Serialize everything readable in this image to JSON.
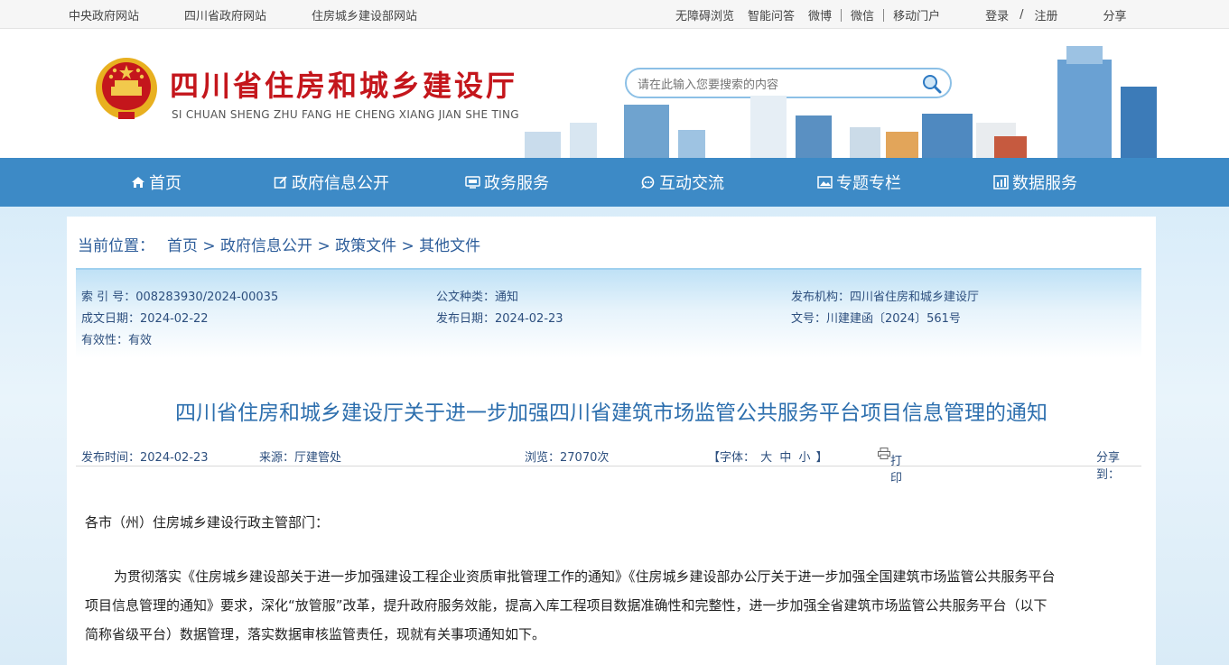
{
  "topbar": {
    "left_links": [
      "中央政府网站",
      "四川省政府网站",
      "住房城乡建设部网站"
    ],
    "right_links": [
      "无障碍浏览",
      "智能问答",
      "微博",
      "微信",
      "移动门户"
    ],
    "login": "登录",
    "slash": "/",
    "register": "注册",
    "share": "分享"
  },
  "header": {
    "title": "四川省住房和城乡建设厅",
    "subtitle": "SI CHUAN SHENG ZHU FANG HE CHENG XIANG JIAN SHE TING",
    "search_placeholder": "请在此输入您要搜索的内容"
  },
  "nav": {
    "items": [
      {
        "label": "首页",
        "icon": "home-icon"
      },
      {
        "label": "政府信息公开",
        "icon": "edit-icon"
      },
      {
        "label": "政务服务",
        "icon": "monitor-icon"
      },
      {
        "label": "互动交流",
        "icon": "chat-icon"
      },
      {
        "label": "专题专栏",
        "icon": "image-icon"
      },
      {
        "label": "数据服务",
        "icon": "chart-icon"
      }
    ]
  },
  "breadcrumb": {
    "label": "当前位置：",
    "path": "首页 > 政府信息公开 > 政策文件 > 其他文件"
  },
  "meta": {
    "index_no": "索 引 号：008283930/2024-00035",
    "doc_type": "公文种类：通知",
    "publisher": "发布机构：四川省住房和城乡建设厅",
    "created": "成文日期：2024-02-22",
    "published": "发布日期：2024-02-23",
    "doc_no": "文号：川建建函〔2024〕561号",
    "validity": "有效性：有效"
  },
  "article": {
    "title": "四川省住房和城乡建设厅关于进一步加强四川省建筑市场监管公共服务平台项目信息管理的通知",
    "publish_time": "发布时间：2024-02-23",
    "source": "来源：厅建管处",
    "views": "浏览：27070次",
    "font_label": "【字体：",
    "font_large": "大",
    "font_medium": "中",
    "font_small": "小",
    "font_close": "】",
    "print": "打印",
    "share_to": "分享到：",
    "salutation": "各市（州）住房城乡建设行政主管部门：",
    "para1_line1": "为贯彻落实《住房城乡建设部关于进一步加强建设工程企业资质审批管理工作的通知》《住房城乡建设部办公厅关于进一步加强全国建筑市场监管公共服务平台",
    "para1_line2": "项目信息管理的通知》要求，深化“放管服”改革，提升政府服务效能，提高入库工程项目数据准确性和完整性，进一步加强全省建筑市场监管公共服务平台（以下",
    "para1_line3": "简称省级平台）数据管理，落实数据审核监管责任，现就有关事项通知如下。"
  },
  "colors": {
    "nav_bg": "#3d8ac6",
    "title_red": "#c4161c",
    "title_blue": "#2d6fae"
  }
}
